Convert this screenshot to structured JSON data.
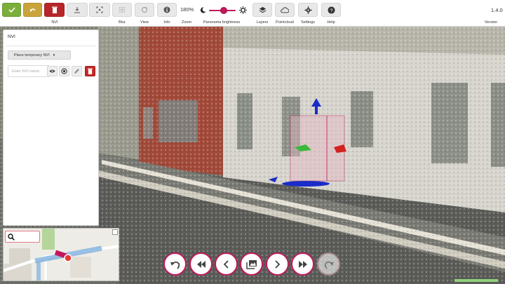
{
  "toolbar": {
    "nvi_label": "NVI",
    "blur_label": "Blur",
    "view_label": "View",
    "info_label": "Info",
    "zoom_label": "Zoom",
    "zoom_value": "180%",
    "panorama_label": "Panorama brightness",
    "panorama_brightness": 0.55,
    "layers_label": "Layers",
    "pointcloud_label": "Pointcloud",
    "settings_label": "Settings",
    "help_label": "Help",
    "version_value": "1.4.0",
    "version_label": "Version"
  },
  "nvi_panel": {
    "title": "NVI",
    "place_button_label": "Place temporary NVI",
    "input_placeholder": "Enter NVI name",
    "input_value": ""
  },
  "bottom_nav": {
    "buttons": [
      "undo-icon",
      "rewind-icon",
      "previous-icon",
      "panorama-gallery-icon",
      "next-icon",
      "fast-forward-icon",
      "redo-icon"
    ]
  },
  "colors": {
    "accent": "#c2185b",
    "confirm_green": "#7cae3b",
    "undo_yellow": "#c9a43a",
    "delete_red": "#b8262a"
  }
}
